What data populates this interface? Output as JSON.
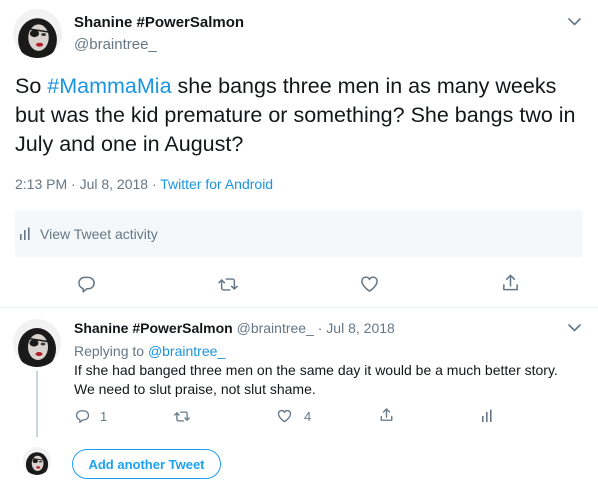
{
  "main_tweet": {
    "author_name": "Shanine #PowerSalmon",
    "author_handle": "@braintree_",
    "text_before": "So ",
    "hashtag": "#MammaMia",
    "text_after": " she bangs three men in as many weeks but was the kid premature or something? She bangs two in July and one in August?",
    "timestamp": "2:13 PM · Jul 8, 2018 · ",
    "source": "Twitter for Android",
    "activity_label": "View Tweet activity",
    "icons": {
      "caret": "chevron-down-icon",
      "activity": "bar-chart-icon",
      "reply": "reply-icon",
      "retweet": "retweet-icon",
      "like": "heart-icon",
      "share": "share-icon"
    }
  },
  "reply_tweet": {
    "author_name": "Shanine #PowerSalmon",
    "handle_and_date": " @braintree_ · Jul 8, 2018",
    "replying_prefix": "Replying to ",
    "replying_mention": "@braintree_",
    "text": "If she had banged three men on the same day it would be a much better story. We need to slut praise, not slut shame.",
    "reply_count": "1",
    "like_count": "4"
  },
  "compose": {
    "add_button_label": "Add another Tweet"
  },
  "colors": {
    "accent": "#1da1f2",
    "link": "#1b95e0",
    "secondary_text": "#657786",
    "icon": "#657786",
    "divider": "#e6ecf0"
  }
}
